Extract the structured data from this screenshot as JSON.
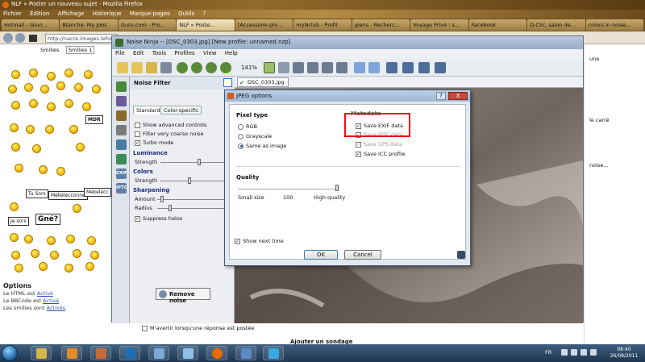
{
  "firefox": {
    "window_title": "NLF » Poster un nouveau sujet - Mozilla Firefox",
    "menu": [
      "Fichier",
      "Édition",
      "Affichage",
      "Historique",
      "Marque-pages",
      "Outils",
      "?"
    ],
    "tabs": [
      "Hotmail - lalun...",
      "Blanche: My Jobs",
      "Guru.com - Pro...",
      "NLF » Poste...",
      "[Accessoire phi...",
      "myNclub - Profil",
      "giens - Recherc...",
      "Voyage Privé : s...",
      "Facebook",
      "D-Clic, salon de...",
      "colors in noise..."
    ],
    "url": "http://nacre.images.lefor..."
  },
  "page": {
    "smilies_label": "Smilies",
    "smilies_select": "Smilies 1",
    "stickers": [
      "MDR",
      "Tu Sors",
      "Mékélécconne",
      "Mékélécc",
      "Je sors",
      "Gné?"
    ],
    "options_title": "Options",
    "options_lines": [
      {
        "text": "Le HTML est",
        "link": "Activé"
      },
      {
        "text": "Le BBCode est",
        "link": "Activé"
      },
      {
        "text": "Les smilies sont",
        "link": "Activés"
      }
    ],
    "right_snippets": [
      "une",
      "le carré",
      "noise..."
    ],
    "notify_label": "M'avertir lorsqu'une réponse est postée",
    "add_poll": "Ajouter un sondage"
  },
  "noise_ninja": {
    "title": "Noise Ninja -- [DSC_0303.jpg] [New profile: unnamed.nzp]",
    "menu": [
      "File",
      "Edit",
      "Tools",
      "Profiles",
      "View",
      "Help"
    ],
    "zoom": "141%",
    "sidebar_labels": [
      "EXIF",
      "IPTC"
    ],
    "filter": {
      "header": "Noise Filter",
      "tab_standard": "Standard",
      "tab_color": "Color-specific",
      "show_advanced": "Show advanced controls",
      "filter_coarse": "Filter very coarse noise",
      "turbo": "Turbo mode",
      "luminance": "Luminance",
      "strength": "Strength",
      "colors": "Colors",
      "sharpening": "Sharpening",
      "amount": "Amount",
      "radius": "Radius",
      "suppress": "Suppress halos",
      "remove_noise": "Remove noise"
    },
    "image_tab": "DSC_0303.jpg"
  },
  "jpeg_dialog": {
    "title": "JPEG options",
    "help": "?",
    "close": "X",
    "pixel_type": "Pixel type",
    "rgb": "RGB",
    "grayscale": "Grayscale",
    "same_as_image": "Same as image",
    "metadata": "Metadata",
    "save_exif": "Save EXIF data",
    "save_iptc": "Save IPTC data",
    "save_gps": "Save GPS data",
    "save_icc": "Save ICC profile",
    "quality": "Quality",
    "small_size": "Small size",
    "quality_value": "100",
    "high_quality": "High quality",
    "show_next_time": "Show next time",
    "ok": "OK",
    "cancel": "Cancel"
  },
  "taskbar": {
    "lang": "FR",
    "time": "08:40",
    "date": "26/08/2011"
  },
  "colors": {
    "highlight": "#e0141a",
    "ps_blue": "#1c6fb5",
    "firefox_orange": "#e66b00"
  }
}
